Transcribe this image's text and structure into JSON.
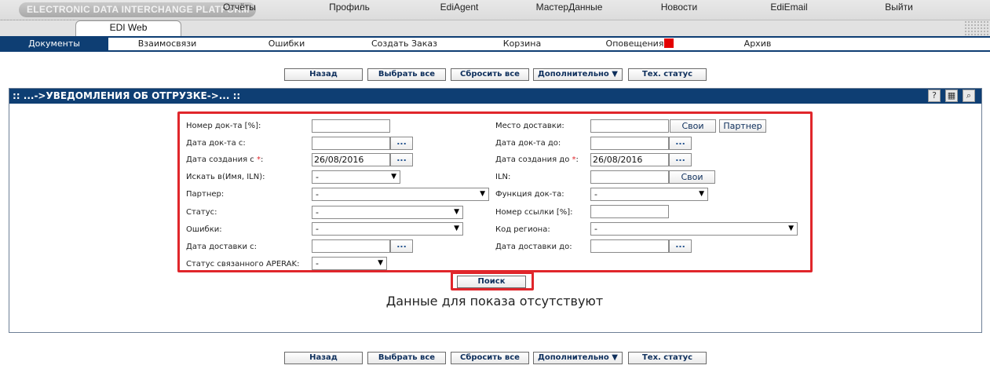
{
  "header": {
    "platform_title": "ELECTRONIC DATA INTERCHANGE PLATFORM"
  },
  "main_menu": {
    "active": "EDI Web",
    "items": [
      "Отчёты",
      "Профиль",
      "EdiAgent",
      "МастерДанные",
      "Новости",
      "EdiEmail",
      "Выйти"
    ]
  },
  "sub_menu": {
    "active": "Документы",
    "items": [
      "Взаимосвязи",
      "Ошибки",
      "Создать Заказ",
      "Корзина",
      "Оповещения",
      "Архив"
    ]
  },
  "toolbar": {
    "back": "Назад",
    "select_all": "Выбрать все",
    "reset_all": "Сбросить все",
    "more": "Дополнительно ▼",
    "tech_status": "Тех. статус"
  },
  "panel": {
    "title": ":: ...->УВЕДОМЛЕНИЯ ОБ ОТГРУЗКЕ->... ::"
  },
  "filters": {
    "left": {
      "doc_number": {
        "label": "Номер док-та [%]:",
        "value": ""
      },
      "doc_date_from": {
        "label": "Дата док-та с:",
        "value": ""
      },
      "created_from": {
        "label": "Дата создания с ",
        "required": "*",
        "label_suffix": ":",
        "value": "26/08/2016"
      },
      "search_in": {
        "label": "Искать в(Имя, ILN):",
        "value": "-"
      },
      "partner": {
        "label": "Партнер:",
        "value": "-"
      },
      "status": {
        "label": "Статус:",
        "value": "-"
      },
      "errors": {
        "label": "Ошибки:",
        "value": "-"
      },
      "delivery_date_from": {
        "label": "Дата доставки с:",
        "value": ""
      },
      "aperak_status": {
        "label": "Статус связанного APERAK:",
        "value": "-"
      }
    },
    "right": {
      "delivery_place": {
        "label": "Место доставки:",
        "value": "",
        "own_btn": "Свои",
        "partner_btn": "Партнер"
      },
      "doc_date_to": {
        "label": "Дата док-та до:",
        "value": ""
      },
      "created_to": {
        "label": "Дата создания до ",
        "required": "*",
        "label_suffix": ":",
        "value": "26/08/2016"
      },
      "iln": {
        "label": "ILN:",
        "value": "",
        "own_btn": "Свои"
      },
      "doc_function": {
        "label": "Функция док-та:",
        "value": "-"
      },
      "ref_number": {
        "label": "Номер ссылки [%]:",
        "value": ""
      },
      "region_code": {
        "label": "Код региона:",
        "value": "-"
      },
      "delivery_date_to": {
        "label": "Дата доставки до:",
        "value": ""
      }
    },
    "dots": "...",
    "search_button": "Поиск"
  },
  "no_data_message": "Данные для показа отсутствуют",
  "colors": {
    "nav_blue": "#0e3e73",
    "highlight_red": "#e0262b",
    "notify_flag": "#e30000"
  }
}
